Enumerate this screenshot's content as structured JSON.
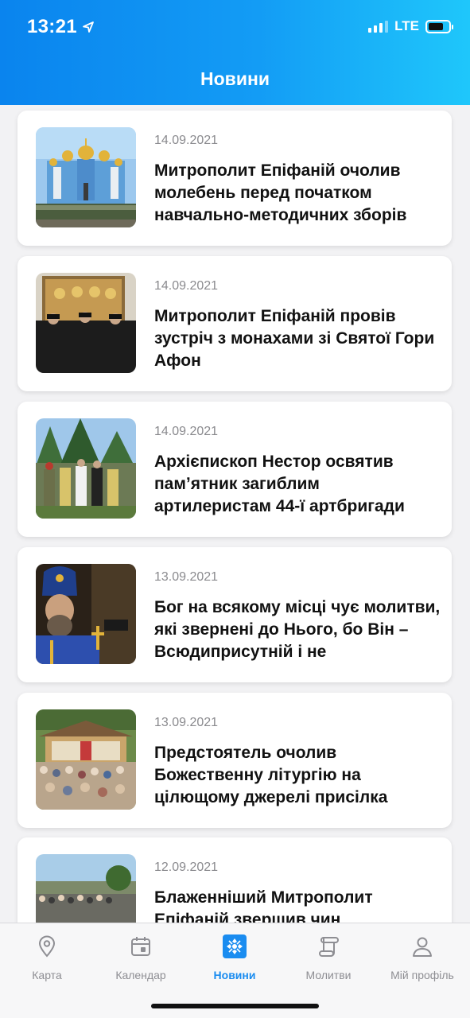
{
  "status_bar": {
    "time": "13:21",
    "network": "LTE",
    "location_icon": "location-arrow-icon"
  },
  "header": {
    "title": "Новини"
  },
  "news": [
    {
      "date": "14.09.2021",
      "title": "Митрополит Епіфаній очолив молебень перед початком навчально-методичних зборів"
    },
    {
      "date": "14.09.2021",
      "title": "Митрополит Епіфаній провів зустріч з монахами зі Святої Гори Афон"
    },
    {
      "date": "14.09.2021",
      "title": "Архієпископ Нестор освятив памʼятник загиблим артилеристам 44-ї артбригади"
    },
    {
      "date": "13.09.2021",
      "title": "Бог на всякому місці чує молитви, які звернені до Нього, бо Він – Всюдиприсутній і не"
    },
    {
      "date": "13.09.2021",
      "title": "Предстоятель очолив Божественну літургію на цілющому джерелі присілка"
    },
    {
      "date": "12.09.2021",
      "title": "Блаженніший Митрополит Епіфаній звершив чин"
    }
  ],
  "tabs": [
    {
      "label": "Карта",
      "icon": "map-pin-icon"
    },
    {
      "label": "Календар",
      "icon": "calendar-icon"
    },
    {
      "label": "Новини",
      "icon": "news-cross-icon",
      "active": true
    },
    {
      "label": "Молитви",
      "icon": "scroll-icon"
    },
    {
      "label": "Мій профіль",
      "icon": "profile-icon"
    }
  ],
  "colors": {
    "header_start": "#0a84ee",
    "header_end": "#1fc7fb",
    "accent": "#1a8cf0"
  }
}
